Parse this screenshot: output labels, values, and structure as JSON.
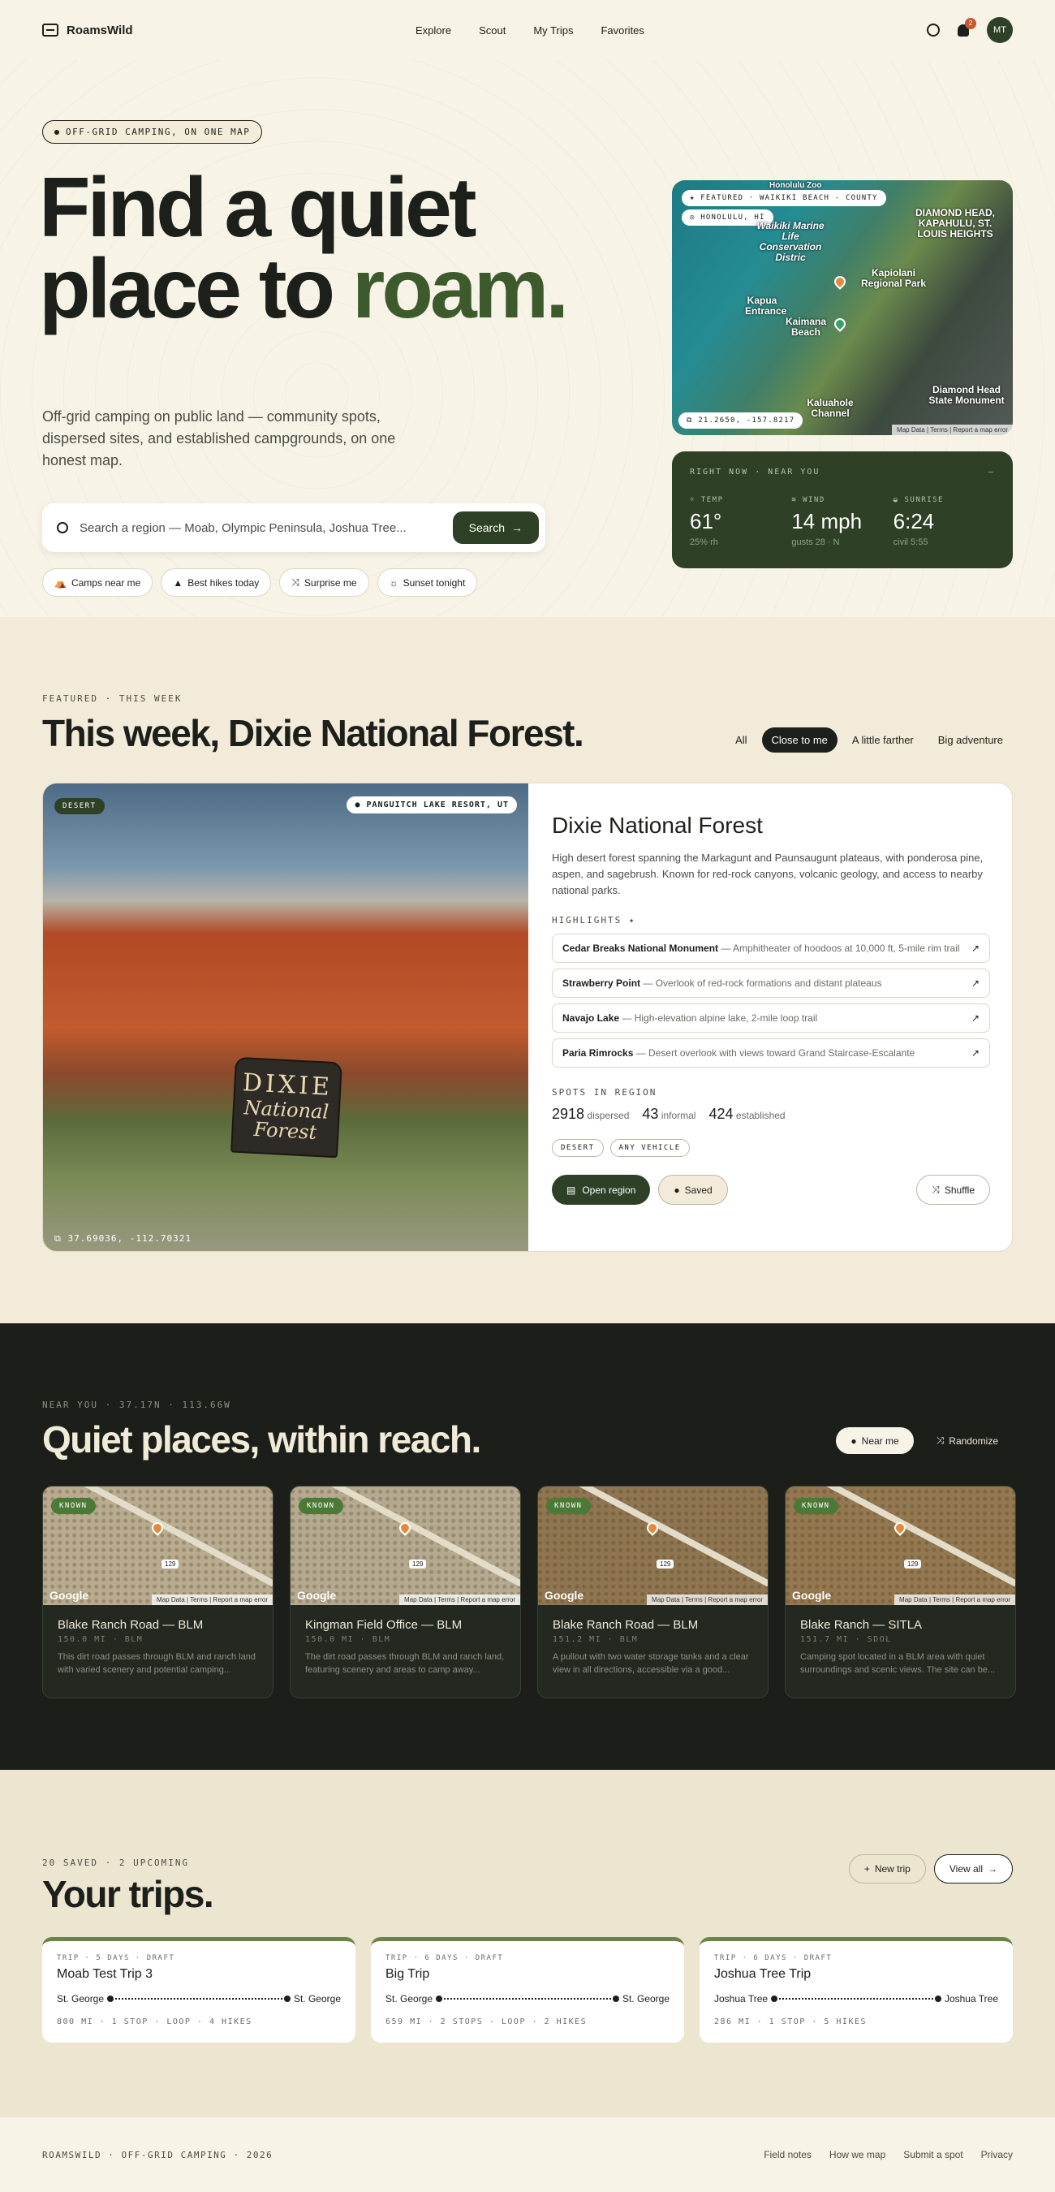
{
  "nav": {
    "brand": "RoamsWild",
    "links": [
      "Explore",
      "Scout",
      "My Trips",
      "Favorites"
    ],
    "notifications": "2",
    "avatar": "MT"
  },
  "hero": {
    "pill": "OFF-GRID CAMPING, ON ONE MAP",
    "title_line1": "Find a quiet",
    "title_line2a": "place to ",
    "title_line2b": "roam.",
    "lede": "Off-grid camping on public land — community spots, dispersed sites, and established campgrounds, on one honest map.",
    "search_placeholder": "Search a region — Moab, Olympic Peninsula, Joshua Tree...",
    "search_button": "Search",
    "chips": [
      "Camps near me",
      "Best hikes today",
      "Surprise me",
      "Sunset tonight"
    ]
  },
  "map": {
    "featured": "FEATURED · WAIKIKI BEACH - COUNTY",
    "location": "HONOLULU, HI",
    "coords": "21.2650, -157.8217",
    "labels": [
      "DIAMOND HEAD, KAPAHULU, ST. LOUIS HEIGHTS",
      "Waikiki Marine Life Conservation Distric",
      "Kapiolani Regional Park",
      "Kapua Entrance",
      "Kaimana Beach",
      "Kaluahole Channel",
      "Diamond Head State Monument",
      "Honolulu Zoo"
    ],
    "footer": "Map Data | Terms | Report a map error"
  },
  "weather": {
    "header": "RIGHT NOW · NEAR YOU",
    "dash": "—",
    "cols": [
      {
        "label": "TEMP",
        "value": "61°",
        "sub": "25% rh"
      },
      {
        "label": "WIND",
        "value": "14 mph",
        "sub": "gusts 28 · N"
      },
      {
        "label": "SUNRISE",
        "value": "6:24",
        "sub": "civil 5:55"
      }
    ]
  },
  "featured": {
    "kicker": "FEATURED · THIS WEEK",
    "title": "This week, Dixie National Forest.",
    "filters": [
      "All",
      "Close to me",
      "A little farther",
      "Big adventure"
    ],
    "photo_tag": "DESERT",
    "photo_loc": "PANGUITCH LAKE RESORT, UT",
    "photo_coords": "37.69036, -112.70321",
    "sign_l1": "DIXIE",
    "sign_l2": "National",
    "sign_l3": "Forest",
    "name": "Dixie National Forest",
    "desc": "High desert forest spanning the Markagunt and Paunsaugunt plateaus, with ponderosa pine, aspen, and sagebrush. Known for red-rock canyons, volcanic geology, and access to nearby national parks.",
    "highlights_label": "HIGHLIGHTS",
    "highlights": [
      {
        "name": "Cedar Breaks National Monument",
        "desc": " — Amphitheater of hoodoos at 10,000 ft, 5-mile rim trail"
      },
      {
        "name": "Strawberry Point",
        "desc": " — Overlook of red-rock formations and distant plateaus"
      },
      {
        "name": "Navajo Lake",
        "desc": " — High-elevation alpine lake, 2-mile loop trail"
      },
      {
        "name": "Paria Rimrocks",
        "desc": " — Desert overlook with views toward Grand Staircase-Escalante"
      }
    ],
    "spots_label": "SPOTS IN REGION",
    "spots": [
      {
        "n": "2918",
        "l": "dispersed"
      },
      {
        "n": "43",
        "l": "informal"
      },
      {
        "n": "424",
        "l": "established"
      }
    ],
    "tags": [
      "DESERT",
      "ANY VEHICLE"
    ],
    "open": "Open region",
    "saved": "Saved",
    "shuffle": "Shuffle"
  },
  "near": {
    "kicker": "NEAR YOU · 37.17N · 113.66W",
    "title": "Quiet places, within reach.",
    "near_me": "Near me",
    "randomize": "Randomize",
    "cards": [
      {
        "tag": "KNOWN",
        "name": "Blake Ranch Road — BLM",
        "dist": "150.0 MI · BLM",
        "desc": "This dirt road passes through BLM and ranch land with varied scenery and potential camping...",
        "bg": "#b9ab8e"
      },
      {
        "tag": "KNOWN",
        "name": "Kingman Field Office — BLM",
        "dist": "150.0 MI · BLM",
        "desc": "The dirt road passes through BLM and ranch land, featuring scenery and areas to camp away...",
        "bg": "#b5a98f"
      },
      {
        "tag": "KNOWN",
        "name": "Blake Ranch Road — BLM",
        "dist": "151.2 MI · BLM",
        "desc": "A pullout with two water storage tanks and a clear view in all directions, accessible via a good...",
        "bg": "#8f7650"
      },
      {
        "tag": "KNOWN",
        "name": "Blake Ranch — SITLA",
        "dist": "151.7 MI · SDOL",
        "desc": "Camping spot located in a BLM area with quiet surroundings and scenic views. The site can be...",
        "bg": "#94784f"
      }
    ],
    "google": "Google",
    "map_footer": "Map Data | Terms | Report a map error",
    "road_num": "129"
  },
  "trips": {
    "kicker": "20 SAVED · 2 UPCOMING",
    "title": "Your trips.",
    "new_trip": "New trip",
    "view_all": "View all",
    "cards": [
      {
        "kicker": "TRIP · 5 DAYS · DRAFT",
        "name": "Moab Test Trip 3",
        "from": "St. George",
        "to": "St. George",
        "meta": "800 MI · 1 STOP · LOOP · 4 HIKES"
      },
      {
        "kicker": "TRIP · 6 DAYS · DRAFT",
        "name": "Big Trip",
        "from": "St. George",
        "to": "St. George",
        "meta": "659 MI · 2 STOPS · LOOP · 2 HIKES"
      },
      {
        "kicker": "TRIP · 6 DAYS · DRAFT",
        "name": "Joshua Tree Trip",
        "from": "Joshua Tree",
        "to": "Joshua Tree",
        "meta": "286 MI · 1 STOP · 5 HIKES"
      }
    ]
  },
  "footer": {
    "left": "ROAMSWILD · OFF-GRID CAMPING · 2026",
    "links": [
      "Field notes",
      "How we map",
      "Submit a spot",
      "Privacy"
    ]
  }
}
